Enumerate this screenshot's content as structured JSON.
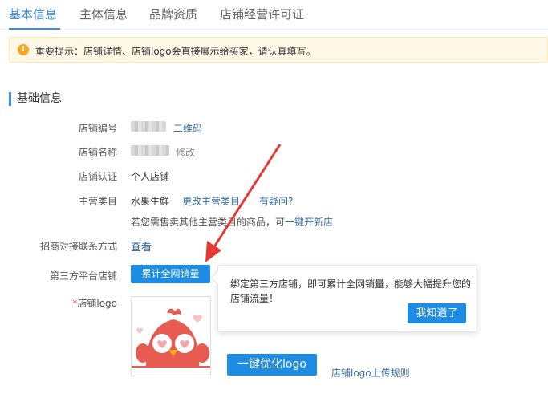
{
  "tabs": [
    {
      "label": "基本信息",
      "active": true
    },
    {
      "label": "主体信息",
      "active": false
    },
    {
      "label": "品牌资质",
      "active": false
    },
    {
      "label": "店铺经营许可证",
      "active": false
    }
  ],
  "notice": {
    "icon": "exclamation-icon",
    "text": "重要提示：店铺详情、店铺logo会直接展示给买家，请认真填写。"
  },
  "section": {
    "title": "基础信息"
  },
  "fields": {
    "shop_id": {
      "label": "店铺编号",
      "link": "二维码"
    },
    "shop_name": {
      "label": "店铺名称",
      "link": "修改"
    },
    "shop_cert": {
      "label": "店铺认证",
      "value": "个人店铺"
    },
    "category": {
      "label": "主营类目",
      "value": "水果生鲜",
      "change_link": "更改主营类目",
      "question_link": "有疑问?",
      "hint_prefix": "若您需售卖其他主营类目的商品，可",
      "hint_link": "一键开新店"
    },
    "contact": {
      "label": "招商对接联系方式",
      "link": "查看"
    },
    "third_party": {
      "label": "第三方平台店铺",
      "button": "累计全网销量"
    },
    "logo": {
      "required_mark": "*",
      "label": "店铺logo",
      "optimize_button": "一键优化logo",
      "rules_link": "店铺logo上传规则"
    }
  },
  "popover": {
    "text": "绑定第三方店铺，即可累计全网销量，能够大幅提升您的店铺流量！",
    "button": "我知道了"
  },
  "colors": {
    "accent": "#3a8ee6",
    "button": "#1e8ce3",
    "arrow": "#e53935",
    "notice_bg": "#fff8e6"
  }
}
